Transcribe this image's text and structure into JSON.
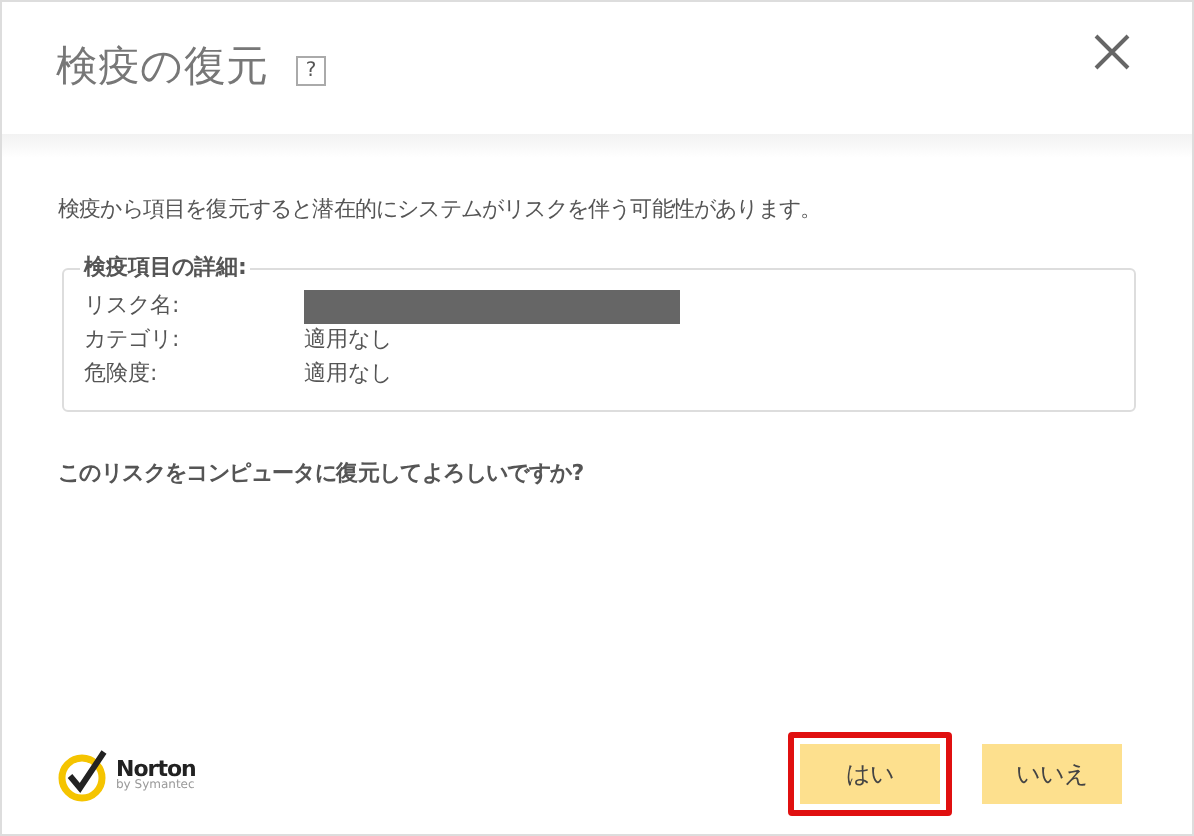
{
  "window": {
    "title": "検疫の復元",
    "help": "?"
  },
  "message": "検疫から項目を復元すると潜在的にシステムがリスクを伴う可能性があります。",
  "details": {
    "legend": "検疫項目の詳細:",
    "rows": [
      {
        "label": "リスク名:",
        "redacted": true
      },
      {
        "label": "カテゴリ:",
        "value": "適用なし",
        "redacted": false
      },
      {
        "label": "危険度:",
        "value": "適用なし",
        "redacted": false
      }
    ]
  },
  "question": "このリスクをコンピュータに復元してよろしいですか?",
  "logo": {
    "name": "Norton",
    "tagline": "by Symantec"
  },
  "buttons": [
    {
      "label": "はい",
      "highlighted": true
    },
    {
      "label": "いいえ",
      "highlighted": false
    }
  ]
}
